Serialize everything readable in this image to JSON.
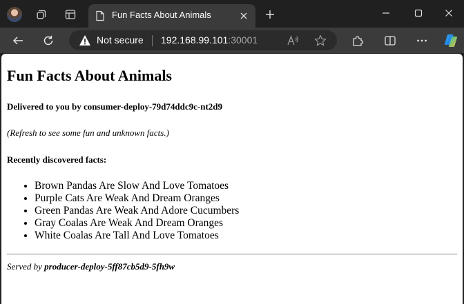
{
  "browser": {
    "tab": {
      "title": "Fun Facts About Animals"
    },
    "address_bar": {
      "security_label": "Not secure",
      "host": "192.168.99.101",
      "port": ":30001"
    },
    "icons": {
      "profile": "avatar",
      "workspaces": "workspaces-icon",
      "tab_actions": "vertical-tabs-icon",
      "favicon": "page-icon",
      "close_tab": "close-icon",
      "new_tab": "plus-icon",
      "minimize": "minimize-icon",
      "maximize": "maximize-icon",
      "close_window": "close-icon",
      "back": "back-arrow-icon",
      "refresh": "refresh-icon",
      "warning": "warning-icon",
      "read_aloud": "read-aloud-icon",
      "favorites": "star-icon",
      "extensions": "puzzle-icon",
      "split_screen": "split-screen-icon",
      "more": "more-icon",
      "copilot": "copilot-icon"
    },
    "colors": {
      "tabstrip_bg": "#202020",
      "active_tab_bg": "#3b3b3b",
      "omnibox_bg": "#2b2b2b",
      "port_text": "#a8a8a8",
      "page_bg": "#ffffff"
    }
  },
  "page": {
    "title": "Fun Facts About Animals",
    "delivered_by": "Delivered to you by consumer-deploy-79d74ddc9c-nt2d9",
    "refresh_note": "(Refresh to see some fun and unknown facts.)",
    "recent_heading": "Recently discovered facts:",
    "facts": [
      "Brown Pandas Are Slow And Love Tomatoes",
      "Purple Cats Are Weak And Dream Oranges",
      "Green Pandas Are Weak And Adore Cucumbers",
      "Gray Coalas Are Weak And Dream Oranges",
      "White Coalas Are Tall And Love Tomatoes"
    ],
    "served_prefix": "Served by",
    "served_by": "producer-deploy-5ff87cb5d9-5fh9w"
  }
}
